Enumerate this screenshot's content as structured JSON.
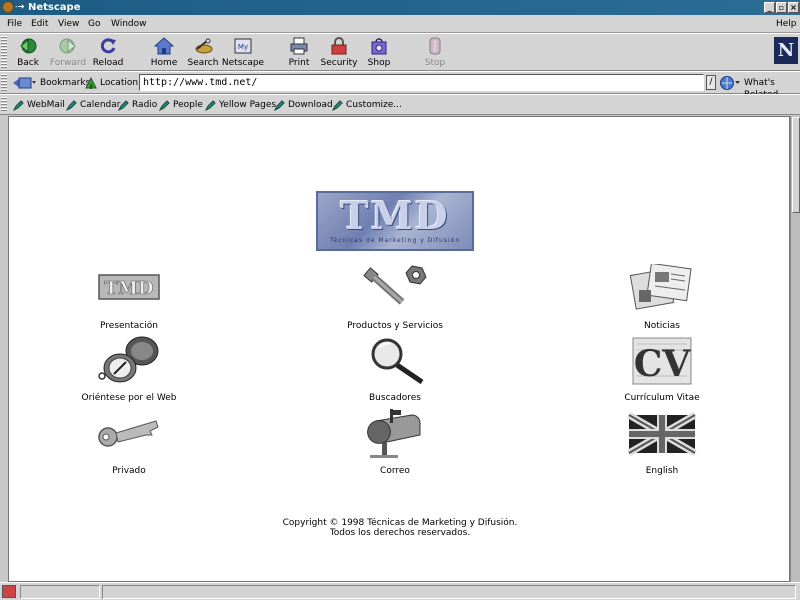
{
  "window": {
    "title": "Netscape",
    "title_marks": "-➜"
  },
  "menubar": {
    "items": [
      "File",
      "Edit",
      "View",
      "Go",
      "Window"
    ],
    "help": "Help"
  },
  "toolbar": {
    "buttons": [
      {
        "label": "Back",
        "icon": "back-arrow-icon",
        "enabled": true
      },
      {
        "label": "Forward",
        "icon": "forward-arrow-icon",
        "enabled": false
      },
      {
        "label": "Reload",
        "icon": "reload-icon",
        "enabled": true
      },
      {
        "label": "Home",
        "icon": "home-icon",
        "enabled": true
      },
      {
        "label": "Search",
        "icon": "search-icon",
        "enabled": true
      },
      {
        "label": "Netscape",
        "icon": "netscape-icon",
        "enabled": true
      },
      {
        "label": "Print",
        "icon": "print-icon",
        "enabled": true
      },
      {
        "label": "Security",
        "icon": "lock-icon",
        "enabled": true
      },
      {
        "label": "Shop",
        "icon": "shop-icon",
        "enabled": true
      },
      {
        "label": "Stop",
        "icon": "stop-icon",
        "enabled": false
      }
    ],
    "logo_letter": "N"
  },
  "locationbar": {
    "bookmarks_label": "Bookmarks",
    "location_label": "Location:",
    "url": "http://www.tmd.net/",
    "whats_related_label": "What's Related"
  },
  "personal_toolbar": {
    "items": [
      "WebMail",
      "Calendar",
      "Radio",
      "People",
      "Yellow Pages",
      "Download",
      "Customize..."
    ]
  },
  "page": {
    "logo_text": "TMD",
    "logo_subtitle": "Técnicas de Marketing y Difusión",
    "links": [
      {
        "label": "Presentación",
        "icon": "tmd-small-logo-icon"
      },
      {
        "label": "Productos y Servicios",
        "icon": "bolt-and-nut-icon"
      },
      {
        "label": "Noticias",
        "icon": "newspapers-icon"
      },
      {
        "label": "Oriéntese por el Web",
        "icon": "compass-icon"
      },
      {
        "label": "Buscadores",
        "icon": "magnifying-glass-icon"
      },
      {
        "label": "Currículum Vitae",
        "icon": "cv-icon"
      },
      {
        "label": "Privado",
        "icon": "key-icon"
      },
      {
        "label": "Correo",
        "icon": "mailbox-icon"
      },
      {
        "label": "English",
        "icon": "union-jack-flag-icon"
      }
    ],
    "copyright_line1": "Copyright © 1998 Técnicas de Marketing y Difusión.",
    "copyright_line2": "Todos los derechos reservados."
  },
  "colors": {
    "titlebar": "#1d5b83",
    "chrome": "#d4d4d4",
    "disabled_text": "#8a8a8a"
  }
}
